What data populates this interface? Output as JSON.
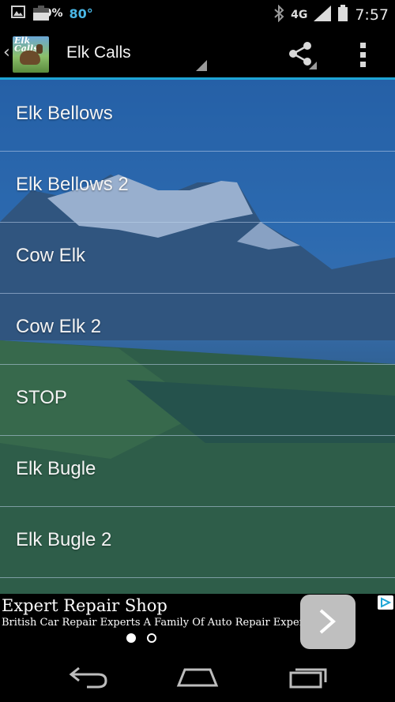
{
  "status_bar": {
    "battery_percent_left": "60%",
    "temperature": "80°",
    "network": "4G",
    "time": "7:57",
    "icons": [
      "image-icon",
      "battery-icon",
      "bluetooth-icon",
      "signal-icon",
      "battery-icon"
    ]
  },
  "action_bar": {
    "logo_text": "Elk Calls",
    "title": "Elk Calls",
    "icons": [
      "up-caret-icon",
      "share-icon",
      "overflow-menu-icon"
    ]
  },
  "list": {
    "items": [
      {
        "label": "Elk Bellows"
      },
      {
        "label": "Elk Bellows 2"
      },
      {
        "label": "Cow Elk"
      },
      {
        "label": "Cow Elk 2"
      },
      {
        "label": "STOP"
      },
      {
        "label": "Elk Bugle"
      },
      {
        "label": "Elk Bugle 2"
      }
    ]
  },
  "ad": {
    "title": "Expert Repair Shop",
    "subtitle": "British Car Repair Experts A Family Of Auto Repair Experts",
    "pager": {
      "pages": 2,
      "current": 1
    }
  },
  "nav_bar": {
    "icons": [
      "back-icon",
      "home-icon",
      "recents-icon"
    ]
  },
  "colors": {
    "accent": "#1ea5d6",
    "temperature": "#4ab7e6"
  }
}
